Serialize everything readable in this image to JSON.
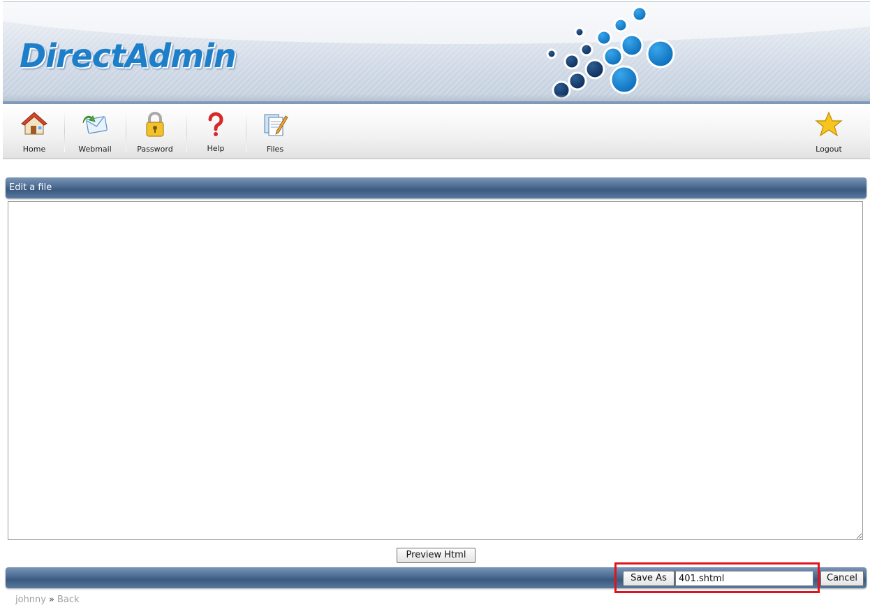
{
  "header": {
    "logo_text": "DirectAdmin"
  },
  "toolbar": {
    "items": [
      {
        "label": "Home",
        "icon": "home-icon"
      },
      {
        "label": "Webmail",
        "icon": "mail-icon"
      },
      {
        "label": "Password",
        "icon": "lock-icon"
      },
      {
        "label": "Help",
        "icon": "help-icon"
      },
      {
        "label": "Files",
        "icon": "files-icon"
      }
    ],
    "logout_label": "Logout",
    "logout_icon": "star-icon"
  },
  "panel": {
    "title": "Edit a file",
    "content": ""
  },
  "actions": {
    "preview_label": "Preview Html",
    "save_as_label": "Save As",
    "filename_value": "401.shtml",
    "cancel_label": "Cancel"
  },
  "breadcrumb": {
    "user": "johnny",
    "separator": "»",
    "back": "Back"
  },
  "colors": {
    "bar": "#4f6f96",
    "logo": "#1d7fc9",
    "highlight": "#e0141c"
  }
}
